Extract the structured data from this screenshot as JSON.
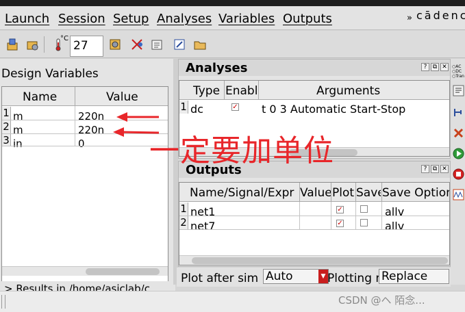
{
  "menu": {
    "items": [
      "Launch",
      "Session",
      "Setup",
      "Analyses",
      "Variables",
      "Outputs"
    ],
    "more": "»",
    "brand": "cādence"
  },
  "toolbar": {
    "temperature_value": "27",
    "temperature_unit": "°C"
  },
  "design_variables": {
    "title": "Design Variables",
    "columns": [
      "Name",
      "Value"
    ],
    "rows": [
      {
        "num": "1",
        "name": "m",
        "value": "220n"
      },
      {
        "num": "2",
        "name": "m",
        "value": "220n"
      },
      {
        "num": "3",
        "name": "in",
        "value": "0"
      }
    ]
  },
  "status_line": "> Results in /home/asiclab/c",
  "analyses": {
    "title": "Analyses",
    "columns": [
      "Type",
      "Enable",
      "Arguments"
    ],
    "rows": [
      {
        "num": "1",
        "type": "dc",
        "enabled": true,
        "args": "t 0 3 Automatic Start-Stop"
      }
    ]
  },
  "outputs": {
    "title": "Outputs",
    "columns": [
      "Name/Signal/Expr",
      "Value",
      "Plot",
      "Save",
      "Save Option"
    ],
    "rows": [
      {
        "num": "1",
        "name": "net1",
        "plot": true,
        "save": false,
        "save_option": "allv"
      },
      {
        "num": "2",
        "name": "net7",
        "plot": true,
        "save": false,
        "save_option": "allv"
      }
    ]
  },
  "dock_buttons": [
    "?",
    "⧉",
    "✕"
  ],
  "bottom": {
    "plot_after_label": "Plot after sim",
    "plot_after_value": "Auto",
    "plotting_label": "Plotting m",
    "plotting_value": "Replace"
  },
  "right_strip_labels": [
    "AC",
    "DC",
    "Tran"
  ],
  "annotation": "一定要加单位",
  "watermark": "CSDN @ヘ 陌念...",
  "colors": {
    "annotation_red": "#e8262a",
    "check_red": "#cc0000"
  }
}
